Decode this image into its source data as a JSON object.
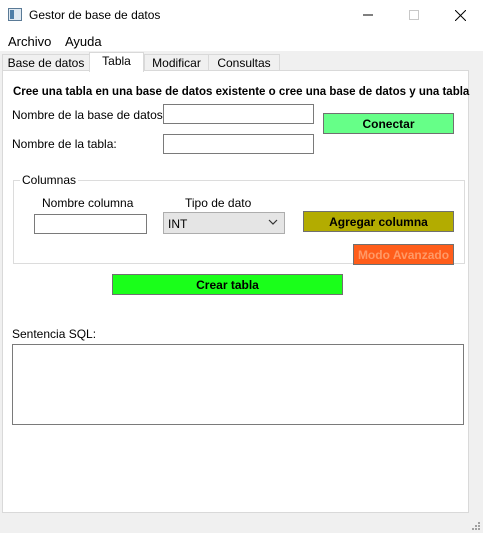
{
  "window": {
    "title": "Gestor de base de datos",
    "minimize": "—",
    "maximize": "☐",
    "close": "✕"
  },
  "menu": {
    "archivo": "Archivo",
    "ayuda": "Ayuda"
  },
  "tabs": [
    {
      "label": "Base de datos"
    },
    {
      "label": "Tabla"
    },
    {
      "label": "Modificar"
    },
    {
      "label": "Consultas"
    }
  ],
  "form": {
    "heading": "Cree una tabla en una base de datos existente o cree una base de datos y una tabla",
    "db_name_label": "Nombre de la base de datos:",
    "db_name_value": "",
    "table_name_label": "Nombre de la tabla:",
    "table_name_value": "",
    "connect_button": "Conectar"
  },
  "columns": {
    "group_title": "Columnas",
    "name_header": "Nombre columna",
    "type_header": "Tipo de dato",
    "name_value": "",
    "type_selected": "INT",
    "add_button": "Agregar columna",
    "advanced_button": "Modo Avanzado"
  },
  "create_button": "Crear tabla",
  "sql": {
    "label": "Sentencia SQL:",
    "value": ""
  },
  "colors": {
    "connect": "#66ff88",
    "add": "#b3ac00",
    "advanced": "#ff5d1a",
    "create": "#1aff1a"
  }
}
